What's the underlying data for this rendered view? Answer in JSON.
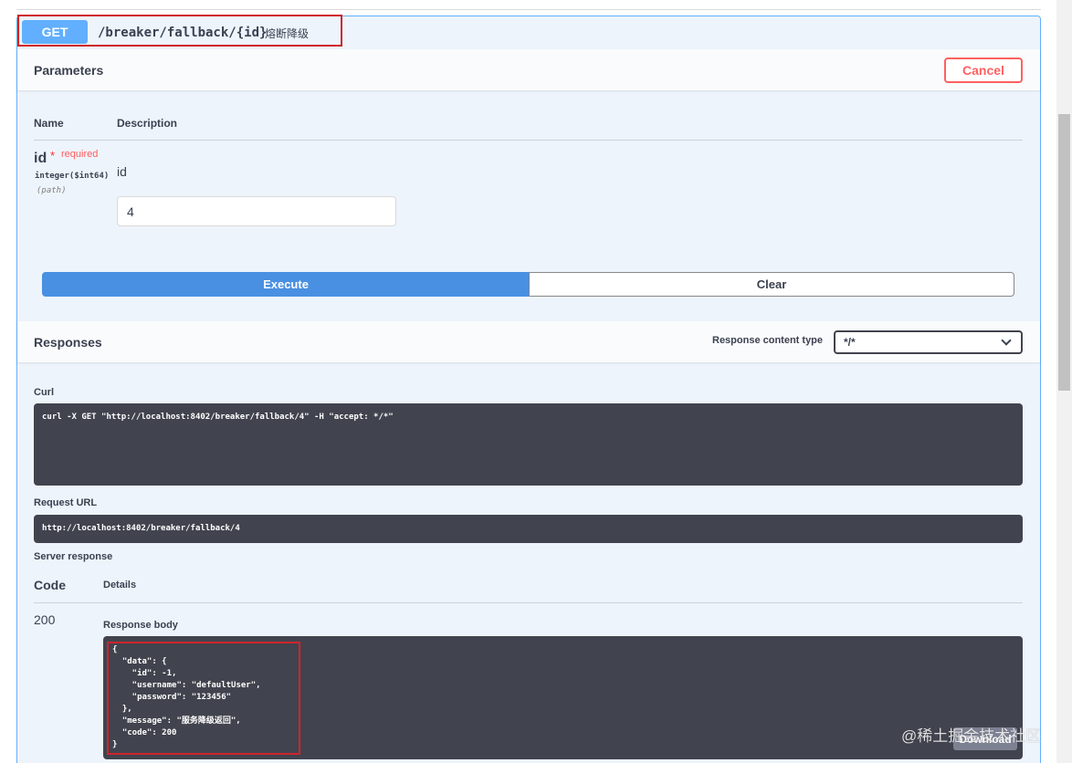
{
  "operation": {
    "method": "GET",
    "path": "/breaker/fallback/{id}",
    "summary": "熔断降级"
  },
  "parameters": {
    "title": "Parameters",
    "cancel_label": "Cancel",
    "col_name": "Name",
    "col_description": "Description",
    "items": [
      {
        "name": "id",
        "required_star": "*",
        "required_label": "required",
        "type": "integer($int64)",
        "in": "(path)",
        "description": "id",
        "value": "4"
      }
    ],
    "execute_label": "Execute",
    "clear_label": "Clear"
  },
  "responses": {
    "title": "Responses",
    "content_type_label": "Response content type",
    "content_type_value": "*/*",
    "curl_label": "Curl",
    "curl_command": "curl -X GET \"http://localhost:8402/breaker/fallback/4\" -H \"accept: */*\"",
    "request_url_label": "Request URL",
    "request_url": "http://localhost:8402/breaker/fallback/4",
    "server_response_label": "Server response",
    "code_col": "Code",
    "details_col": "Details",
    "status_code": "200",
    "body_label": "Response body",
    "body": "{\n  \"data\": {\n    \"id\": -1,\n    \"username\": \"defaultUser\",\n    \"password\": \"123456\"\n  },\n  \"message\": \"服务降级返回\",\n  \"code\": 200\n}",
    "download_label": "Download"
  },
  "watermark": "@稀土掘金技术社区",
  "colors": {
    "get_blue": "#61affe",
    "execute_blue": "#4990e2",
    "cancel_red": "#ff6060",
    "highlight_red": "#d0232b",
    "code_bg": "#41444e"
  },
  "icons": {
    "select_chevron": "chevron-down-icon"
  }
}
